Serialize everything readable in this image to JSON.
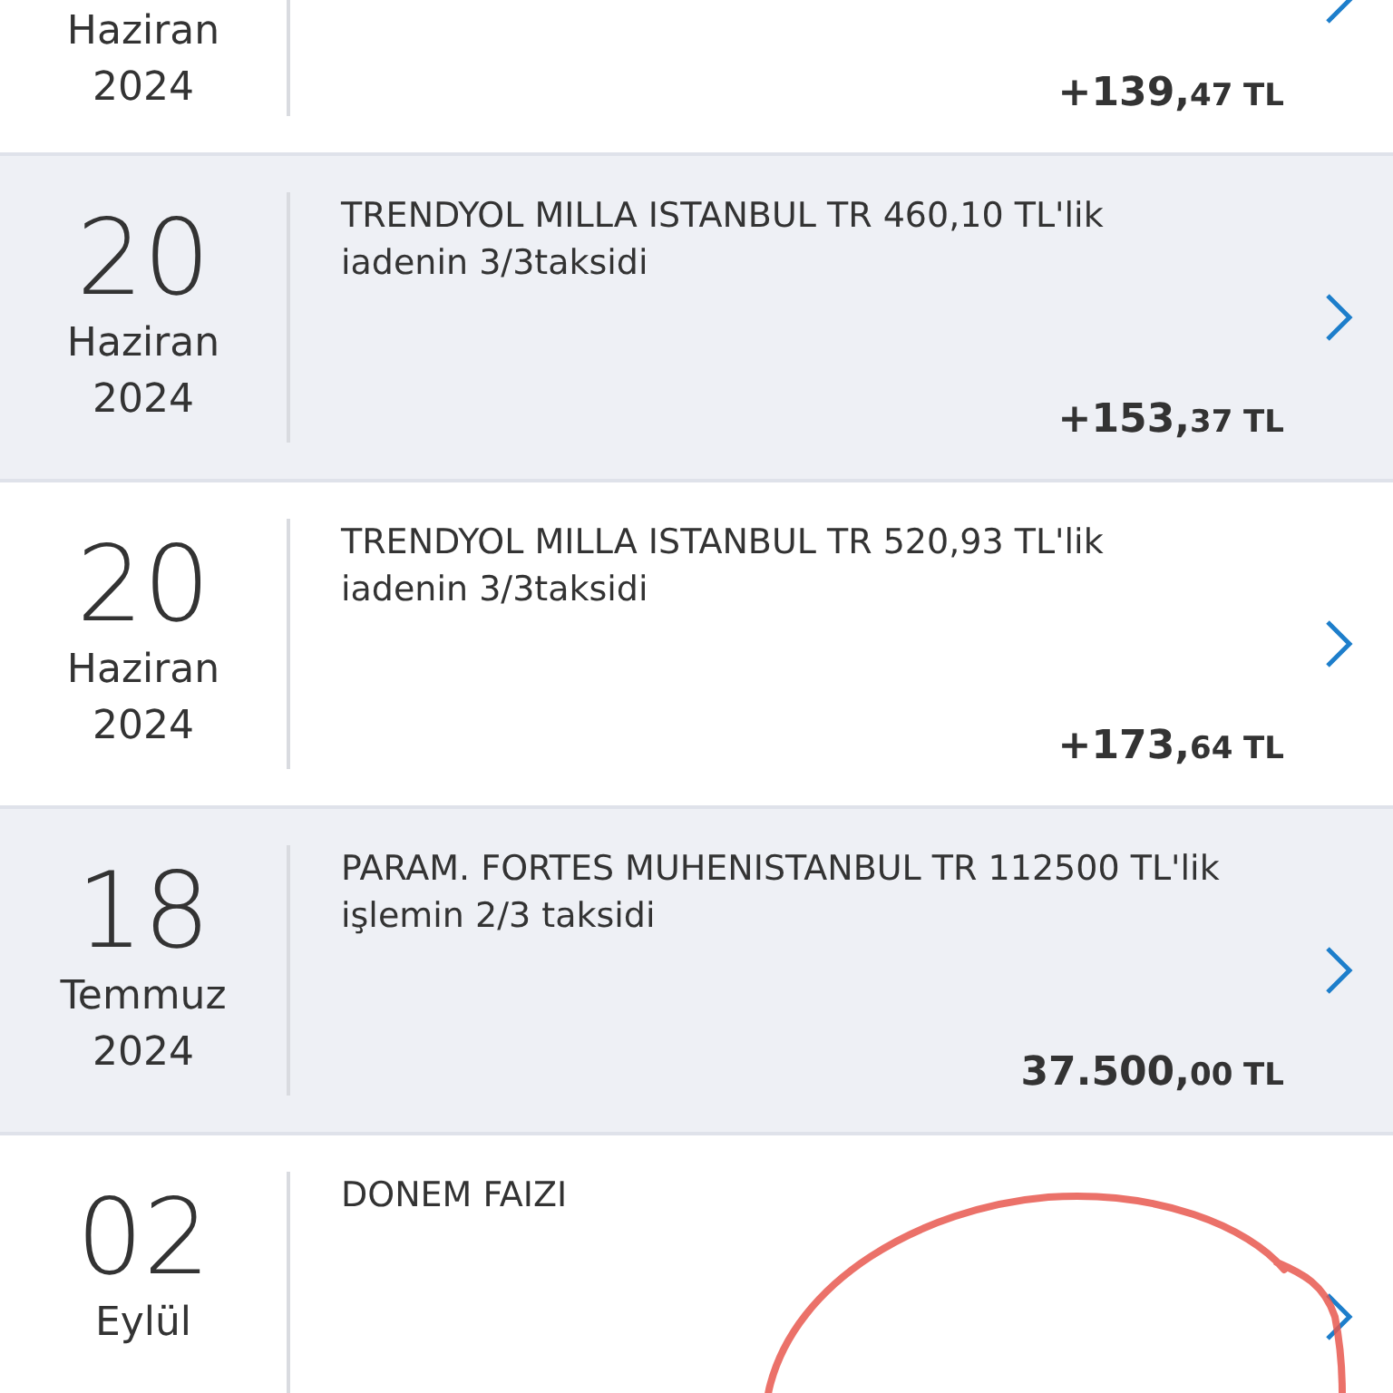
{
  "transactions": [
    {
      "month": "Haziran",
      "year": "2024",
      "amount_whole": "+139,",
      "amount_fraction": "47 TL"
    },
    {
      "day": "20",
      "month": "Haziran",
      "year": "2024",
      "description": "TRENDYOL MILLA ISTANBUL TR 460,10 TL'lik iadenin 3/3taksidi",
      "amount_whole": "+153,",
      "amount_fraction": "37 TL"
    },
    {
      "day": "20",
      "month": "Haziran",
      "year": "2024",
      "description": "TRENDYOL MILLA ISTANBUL TR 520,93 TL'lik iadenin 3/3taksidi",
      "amount_whole": "+173,",
      "amount_fraction": "64 TL"
    },
    {
      "day": "18",
      "month": "Temmuz",
      "year": "2024",
      "description": "PARAM. FORTES MUHENISTANBUL TR 112500 TL'lik işlemin 2/3 taksidi",
      "amount_whole": "37.500,",
      "amount_fraction": "00 TL"
    },
    {
      "day": "02",
      "month": "Eylül",
      "description": "DONEM FAIZI"
    }
  ]
}
